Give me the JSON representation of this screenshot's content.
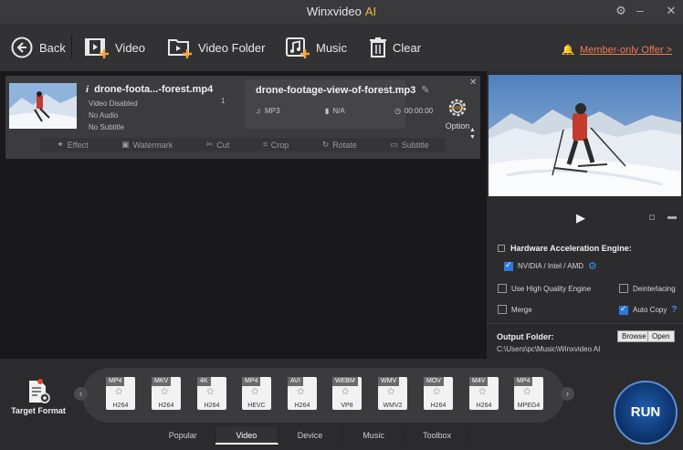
{
  "window": {
    "title": "Winxvideo",
    "title_suffix": "AI"
  },
  "toolbar": {
    "back": "Back",
    "video": "Video",
    "video_folder": "Video Folder",
    "music": "Music",
    "clear": "Clear",
    "member_offer": "Member-only Offer >"
  },
  "task": {
    "source_name": "drone-foota...-forest.mp4",
    "video_status": "Video Disabled",
    "audio_status": "No Audio",
    "subtitle_status": "No Subtitle",
    "track_count": "1",
    "output_name": "drone-footage-view-of-forest.mp3",
    "output_format": "MP3",
    "output_size": "N/A",
    "output_duration": "00:00:00",
    "option_label": "Option",
    "edit_tools": [
      "Effect",
      "Watermark",
      "Cut",
      "Crop",
      "Rotate",
      "Subtitle"
    ]
  },
  "settings": {
    "hw_engine": "Hardware Acceleration Engine:",
    "hw_option": "NVIDIA / Intel / AMD",
    "high_quality": "Use High Quality Engine",
    "deinterlacing": "Deinterlacing",
    "merge": "Merge",
    "auto_copy": "Auto Copy",
    "help": "?"
  },
  "output_folder": {
    "label": "Output Folder:",
    "path": "C:\\Users\\pc\\Music\\Winxvideo AI",
    "browse": "Browse",
    "open": "Open"
  },
  "target_format": "Target Format",
  "formats": [
    {
      "container": "MP4",
      "codec": "H264"
    },
    {
      "container": "MKV",
      "codec": "H264"
    },
    {
      "container": "4K",
      "codec": "H264"
    },
    {
      "container": "MP4",
      "codec": "HEVC"
    },
    {
      "container": "AVI",
      "codec": "H264"
    },
    {
      "container": "WEBM",
      "codec": "VP8"
    },
    {
      "container": "WMV",
      "codec": "WMV2"
    },
    {
      "container": "MOV",
      "codec": "H264"
    },
    {
      "container": "M4V",
      "codec": "H264"
    },
    {
      "container": "MP4",
      "codec": "MPEG4"
    }
  ],
  "tabs": [
    "Popular",
    "Video",
    "Device",
    "Music",
    "Toolbox"
  ],
  "active_tab": "Video",
  "run_label": "RUN",
  "colors": {
    "accent": "#2a7ad8",
    "offer": "#f27a52",
    "brand_ai": "#f2b84a"
  }
}
